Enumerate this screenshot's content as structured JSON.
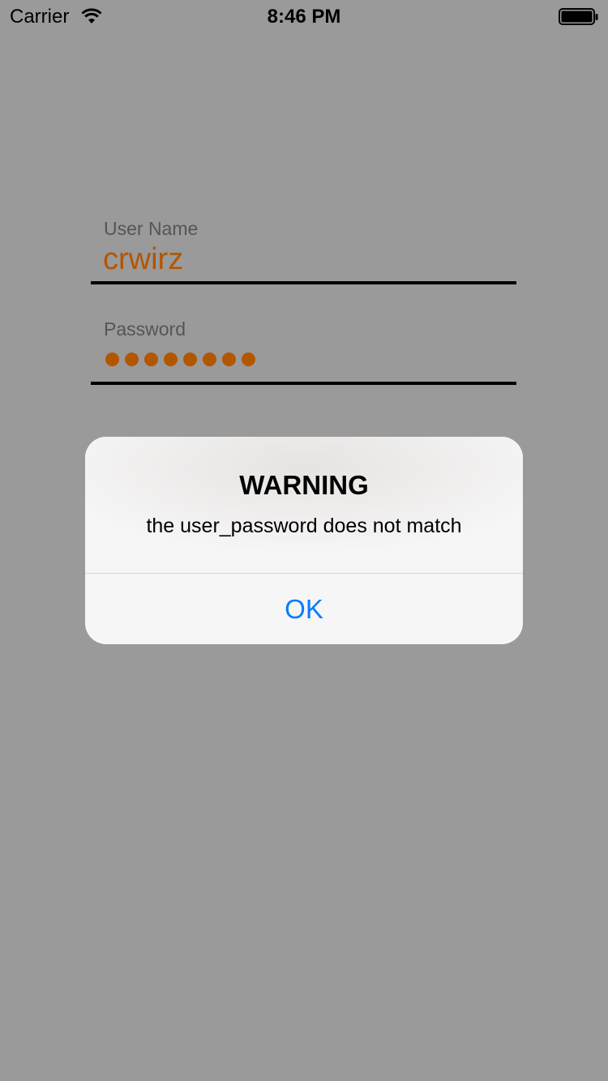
{
  "status_bar": {
    "carrier": "Carrier",
    "time": "8:46 PM",
    "wifi_icon": "wifi-icon",
    "battery_icon": "battery-icon"
  },
  "login": {
    "username_label": "User Name",
    "username_value": "crwirz",
    "password_label": "Password",
    "password_masked_length": 8
  },
  "alert": {
    "title": "WARNING",
    "message": "the user_password does not match",
    "ok_label": "OK"
  },
  "colors": {
    "background": "#9a9a9a",
    "field_text": "#b35600",
    "alert_button": "#0a7aff"
  }
}
